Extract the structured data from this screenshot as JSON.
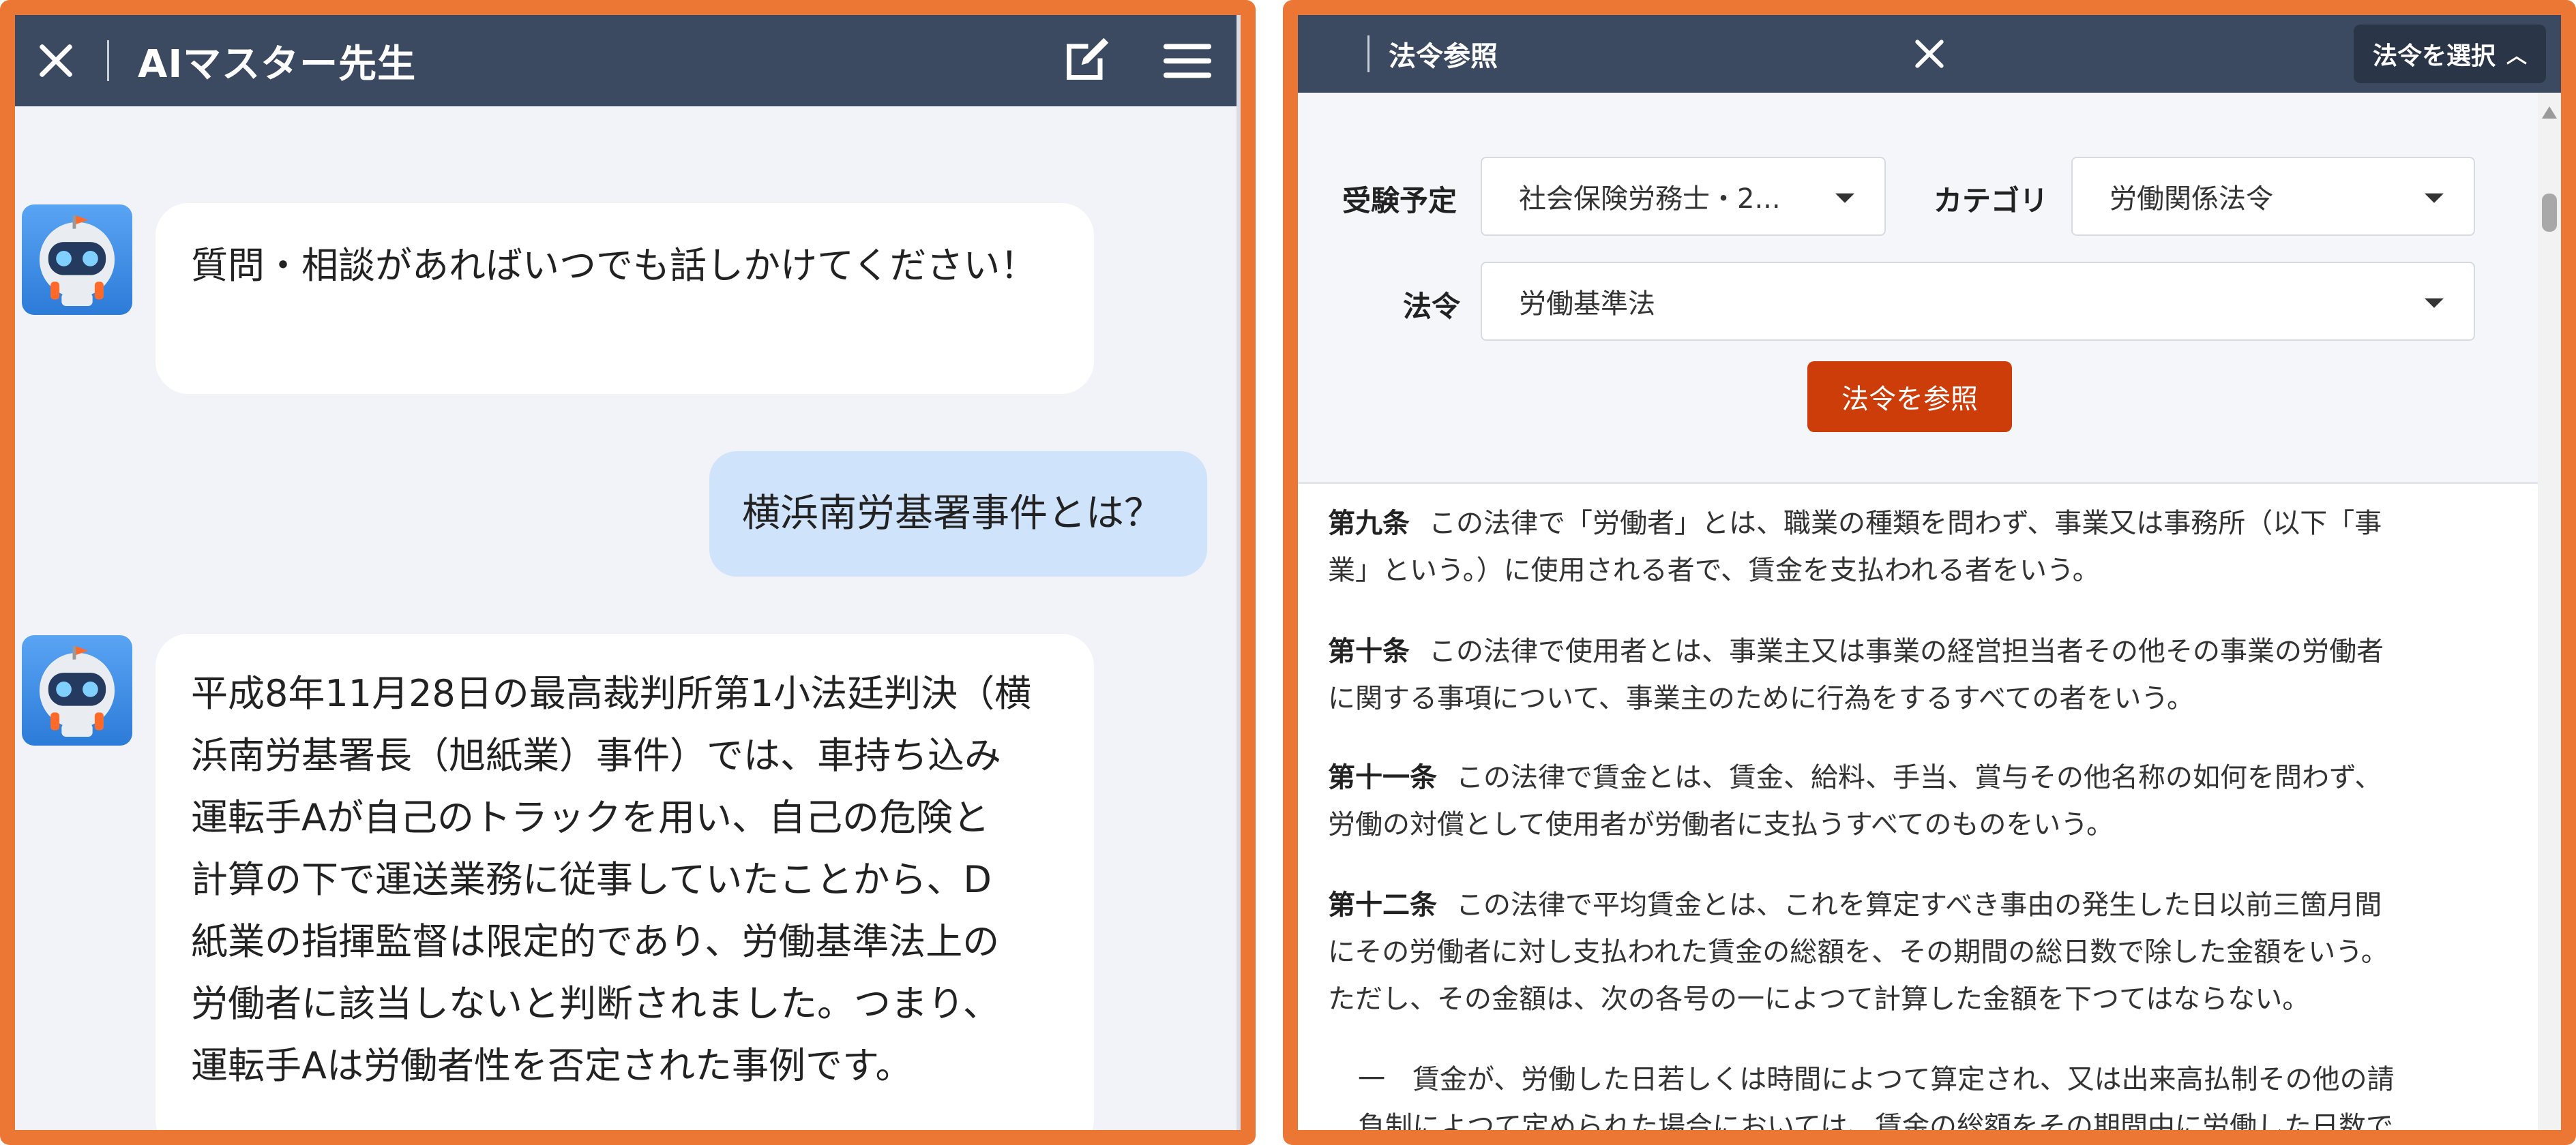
{
  "chat": {
    "title": "AIマスター先生",
    "messages": [
      {
        "role": "assistant",
        "text": "質問・相談があればいつでも話しかけてください！"
      },
      {
        "role": "user",
        "text": "横浜南労基署事件とは？"
      },
      {
        "role": "assistant",
        "lines": [
          "平成8年11月28日の最高裁判所第1小法廷判決（横",
          "浜南労基署長（旭紙業）事件）では、車持ち込み",
          "運転手Aが自己のトラックを用い、自己の危険と",
          "計算の下で運送業務に従事していたことから、D",
          "紙業の指揮監督は限定的であり、労働基準法上の",
          "労働者に該当しないと判断されました。つまり、",
          "運転手Aは労働者性を否定された事例です。"
        ]
      }
    ]
  },
  "law": {
    "title": "法令参照",
    "select_button": "法令を選択",
    "form": {
      "exam_label": "受験予定",
      "exam_value": "社会保険労務士・2...",
      "category_label": "カテゴリ",
      "category_value": "労働関係法令",
      "law_label": "法令",
      "law_value": "労働基準法",
      "submit": "法令を参照"
    },
    "articles": [
      {
        "number": "第九条",
        "lines": [
          "この法律で「労働者」とは、職業の種類を問わず、事業又は事務所（以下「事",
          "業」という。）に使用される者で、賃金を支払われる者をいう。"
        ]
      },
      {
        "number": "第十条",
        "lines": [
          "この法律で使用者とは、事業主又は事業の経営担当者その他その事業の労働者",
          "に関する事項について、事業主のために行為をするすべての者をいう。"
        ]
      },
      {
        "number": "第十一条",
        "lines": [
          "この法律で賃金とは、賃金、給料、手当、賞与その他名称の如何を問わず、",
          "労働の対償として使用者が労働者に支払うすべてのものをいう。"
        ]
      },
      {
        "number": "第十二条",
        "lines": [
          "この法律で平均賃金とは、これを算定すべき事由の発生した日以前三箇月間",
          "にその労働者に対し支払われた賃金の総額を、その期間の総日数で除した金額をいう。",
          "ただし、その金額は、次の各号の一によつて計算した金額を下つてはならない。"
        ]
      }
    ],
    "item_1": "一　賃金が、労働した日若しくは時間によつて算定され、又は出来高払制その他の請",
    "item_1_cut": "負制によつて定められた場合においては、賃金の総額をその期間中に労働した日数で"
  }
}
